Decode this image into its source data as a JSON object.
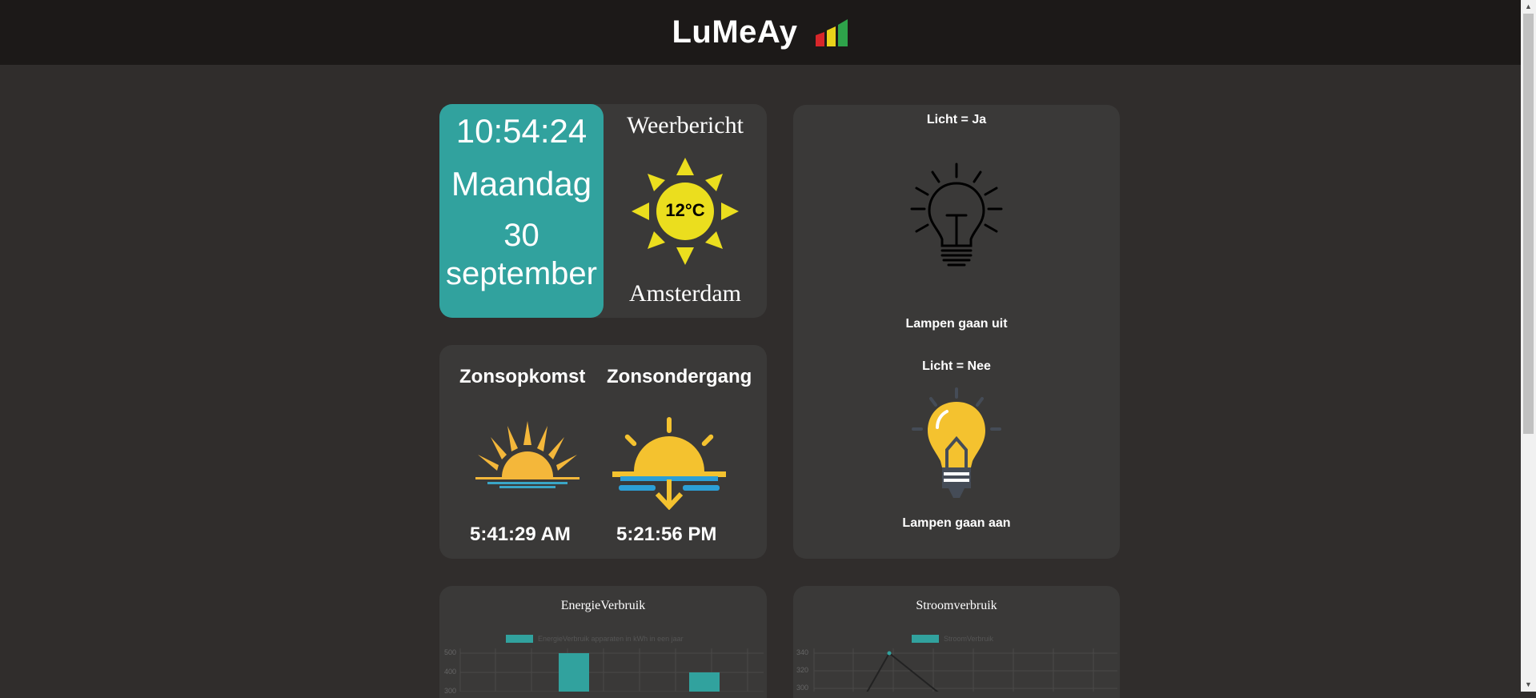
{
  "header": {
    "title": "LuMeAy",
    "logo_icon": "signal-bars-icon"
  },
  "clock": {
    "time": "10:54:24",
    "day": "Maandag",
    "date_day": "30",
    "date_month": "september"
  },
  "weather": {
    "title": "Weerbericht",
    "temperature": "12°C",
    "city": "Amsterdam",
    "icon": "sun-icon"
  },
  "sun": {
    "sunrise_label": "Zonsopkomst",
    "sunset_label": "Zonsondergang",
    "sunrise_time": "5:41:29 AM",
    "sunset_time": "5:21:56 PM"
  },
  "lights": {
    "off_status": "Licht = Ja",
    "off_caption": "Lampen gaan uit",
    "on_status": "Licht = Nee",
    "on_caption": "Lampen gaan aan"
  },
  "colors": {
    "accent": "#31a29e",
    "background": "#302d2c",
    "header": "#1c1918",
    "card": "#3a3938"
  },
  "chart_data": [
    {
      "type": "bar",
      "title": "EnergieVerbruik",
      "series": [
        {
          "name": "EnergieVerbruik apparaten in kWh in een jaar",
          "values": [
            500,
            400
          ]
        }
      ],
      "yticks": [
        "500",
        "400",
        "300"
      ]
    },
    {
      "type": "line",
      "title": "Stroomverbruik",
      "series": [
        {
          "name": "StroomVerbruik",
          "values": [
            340,
            300
          ]
        }
      ],
      "yticks": [
        "340",
        "320",
        "300"
      ]
    }
  ]
}
